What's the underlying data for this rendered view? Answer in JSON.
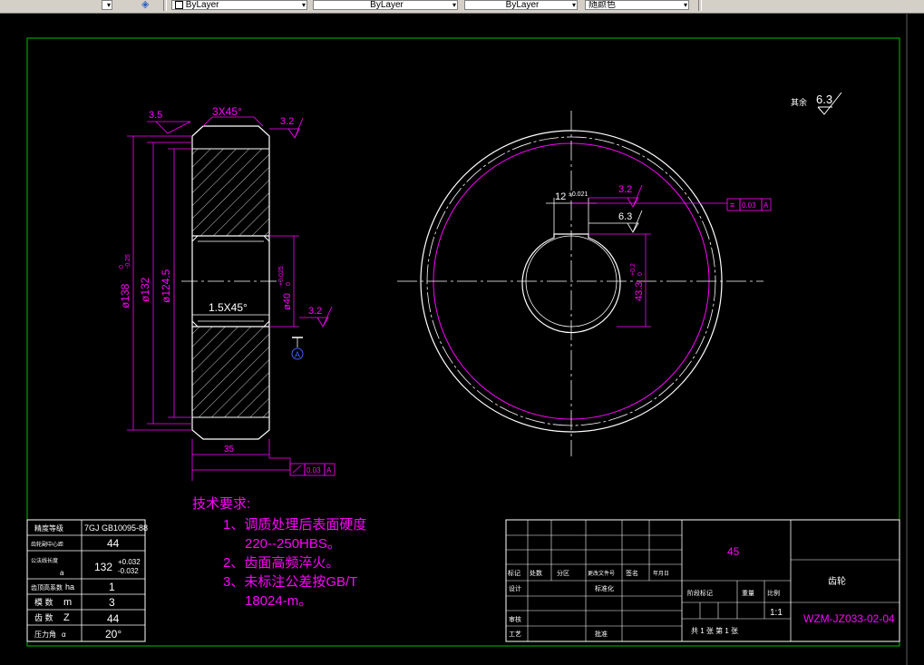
{
  "toolbar": {
    "layer_combo_1": "ByLayer",
    "layer_combo_2": "ByLayer",
    "layer_combo_3": "ByLayer",
    "color_combo": "随颜色"
  },
  "drawing": {
    "roughness_general_label": "其余",
    "roughness_general_value": "6.3",
    "left_view": {
      "chamfer_top": "3X45°",
      "roughness_top_left": "3.5",
      "roughness_top_right": "3.2",
      "roughness_bore": "3.2",
      "chamfer_bore": "1.5X45°",
      "dim_od": "ø138",
      "dim_od_tol_upper": "0",
      "dim_od_tol_lower": "-0.25",
      "dim_pitch": "ø132",
      "dim_root": "ø124.5",
      "dim_bore": "ø40",
      "dim_bore_tol_upper": "+0.025",
      "dim_bore_tol_lower": "0",
      "dim_width": "35",
      "datum_label": "A",
      "runout_value": "0.03",
      "runout_datum": "A"
    },
    "front_view": {
      "key_width": "12",
      "key_width_tol": "±0.021",
      "roughness_key_1": "3.2",
      "roughness_key_2": "6.3",
      "key_depth": "43.3",
      "key_depth_tol_upper": "+0.2",
      "key_depth_tol_lower": "0",
      "symmetry_value": "0.03",
      "symmetry_datum": "A"
    }
  },
  "tech_requirements": {
    "title": "技术要求:",
    "item1_line1": "1、调质处理后表面硬度",
    "item1_line2": "220--250HBS。",
    "item2": "2、齿面高频淬火。",
    "item3_line1": "3、未标注公差按GB/T",
    "item3_line2": "18024-m。"
  },
  "param_table": {
    "rows": [
      {
        "label": "精度等级",
        "sym": "",
        "value": "7GJ GB10095-88"
      },
      {
        "label": "齿轮副中心距",
        "sym": "",
        "value": "44"
      },
      {
        "label": "公法线长度",
        "sym": "a",
        "value": "132"
      },
      {
        "label": "齿顶高系数",
        "sym": "ha",
        "value": "1"
      },
      {
        "label": "模 数",
        "sym": "m",
        "value": "3"
      },
      {
        "label": "齿 数",
        "sym": "Z",
        "value": "44"
      },
      {
        "label": "压力角",
        "sym": "α",
        "value": "20°"
      }
    ],
    "row3_tol_upper": "+0.032",
    "row3_tol_lower": "-0.032"
  },
  "title_block": {
    "material": "45",
    "part_name": "齿轮",
    "drawing_no": "WZM-JZ033-02-04",
    "scale": "1:1",
    "sheets": "共 1 张    第 1 张",
    "h_biaoji": "标记",
    "h_chushu": "处数",
    "h_fenqu": "分区",
    "h_gengwenjian": "更改文件号",
    "h_qianming": "签名",
    "h_date": "年月日",
    "h_sheji": "设计",
    "h_biaozhunhua": "标准化",
    "h_shenhe": "审核",
    "h_gongyi": "工艺",
    "h_pizhun": "批准",
    "h_jieduan": "阶段标记",
    "h_zhongliang": "重量",
    "h_bili": "比例"
  },
  "colors": {
    "background": "#000000",
    "dimension": "#ff00ff",
    "geometry": "#ffffff",
    "border": "#00c000"
  }
}
